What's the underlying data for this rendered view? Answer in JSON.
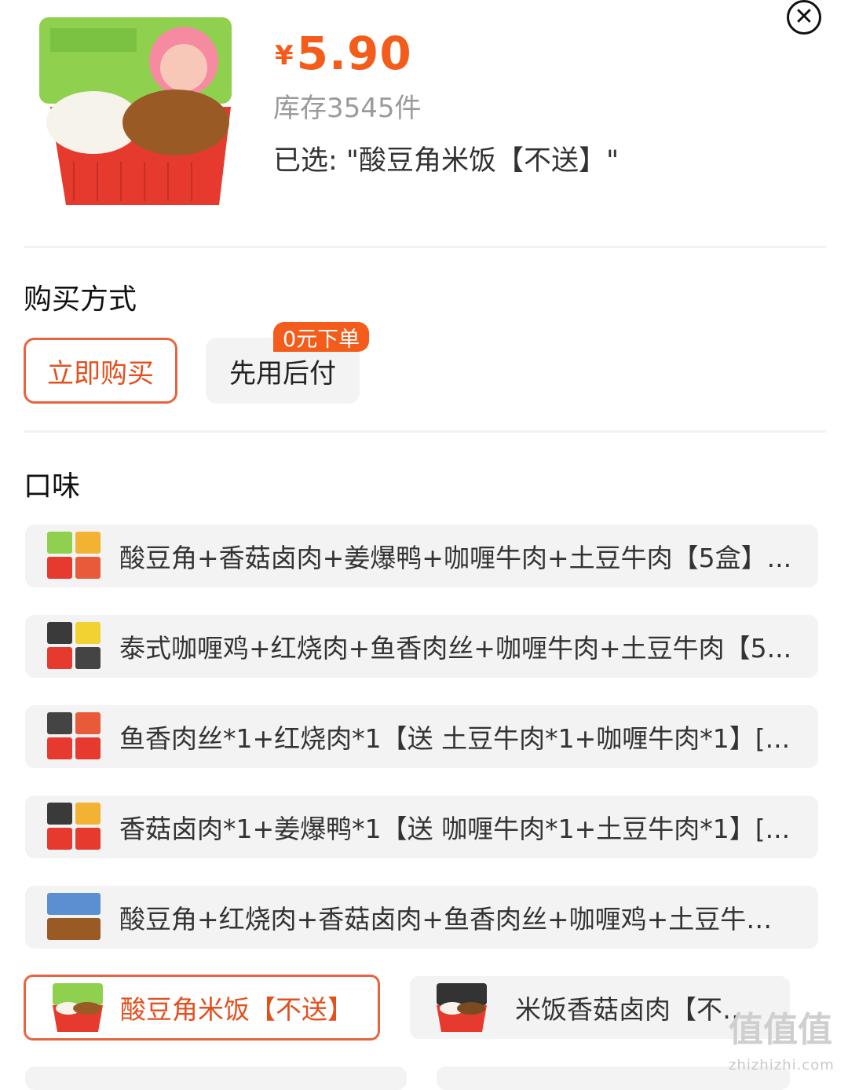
{
  "product": {
    "price_symbol": "¥",
    "price": "5.90",
    "stock": "库存3545件",
    "selected": "已选: \"酸豆角米饭【不送】\""
  },
  "purchase": {
    "title": "购买方式",
    "options": [
      {
        "label": "立即购买",
        "active": true
      },
      {
        "label": "先用后付",
        "active": false
      }
    ],
    "badge": "0元下单"
  },
  "flavor": {
    "title": "口味",
    "options": [
      {
        "label": "酸豆角+香菇卤肉+姜爆鸭+咖喱牛肉+土豆牛肉【5盒】..."
      },
      {
        "label": "泰式咖喱鸡+红烧肉+鱼香肉丝+咖喱牛肉+土豆牛肉【5..."
      },
      {
        "label": "鱼香肉丝*1+红烧肉*1【送 土豆牛肉*1+咖喱牛肉*1】[..."
      },
      {
        "label": "香菇卤肉*1+姜爆鸭*1【送 咖喱牛肉*1+土豆牛肉*1】[..."
      },
      {
        "label": "酸豆角+红烧肉+香菇卤肉+鱼香肉丝+咖喱鸡+土豆牛肉..."
      },
      {
        "label": "酸豆角米饭【不送】",
        "active": true
      },
      {
        "label": "米饭香菇卤肉【不送】",
        "active": false
      }
    ]
  },
  "watermark": {
    "main": "值值值",
    "sub": "zhizhizhi.com"
  },
  "colors": {
    "accent": "#f35c1b",
    "border_active": "#e8643e",
    "option_bg": "#f3f3f3"
  }
}
